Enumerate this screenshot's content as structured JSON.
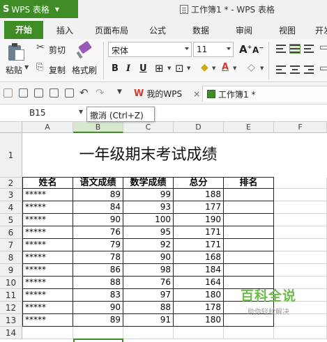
{
  "titlebar": {
    "app_label": "WPS 表格",
    "window_title": "工作簿1 * - WPS 表格"
  },
  "ribbon_tabs": [
    "开始",
    "插入",
    "页面布局",
    "公式",
    "数据",
    "审阅",
    "视图",
    "开发"
  ],
  "ribbon": {
    "paste": "粘贴",
    "cut": "剪切",
    "copy": "复制",
    "format_painter": "格式刷",
    "font_name": "宋体",
    "font_size": "11"
  },
  "quick_bar": {
    "tab_mywps": "我的WPS",
    "tab_book": "工作簿1 *"
  },
  "formula_bar": {
    "cell_ref": "B15"
  },
  "tooltip": "撤消 (Ctrl+Z)",
  "sheet": {
    "columns": [
      "A",
      "B",
      "C",
      "D",
      "E",
      "F"
    ],
    "row_numbers": [
      "1",
      "2",
      "3",
      "4",
      "5",
      "6",
      "7",
      "8",
      "9",
      "10",
      "11",
      "12",
      "13",
      "14"
    ],
    "title": "一年级期末考试成绩",
    "headers": [
      "姓名",
      "语文成绩",
      "数学成绩",
      "总分",
      "排名"
    ],
    "rows": [
      [
        "*****",
        "89",
        "99",
        "188"
      ],
      [
        "*****",
        "84",
        "93",
        "177"
      ],
      [
        "*****",
        "90",
        "100",
        "190"
      ],
      [
        "*****",
        "76",
        "95",
        "171"
      ],
      [
        "*****",
        "79",
        "92",
        "171"
      ],
      [
        "*****",
        "78",
        "90",
        "168"
      ],
      [
        "*****",
        "86",
        "98",
        "184"
      ],
      [
        "*****",
        "88",
        "76",
        "164"
      ],
      [
        "*****",
        "83",
        "97",
        "180"
      ],
      [
        "*****",
        "90",
        "88",
        "178"
      ],
      [
        "*****",
        "89",
        "91",
        "180"
      ]
    ]
  },
  "watermark": {
    "main": "百科全说",
    "sub": "助你轻松解决"
  },
  "colors": {
    "accent": "#3f8b26",
    "watermark": "#6cbc49"
  }
}
